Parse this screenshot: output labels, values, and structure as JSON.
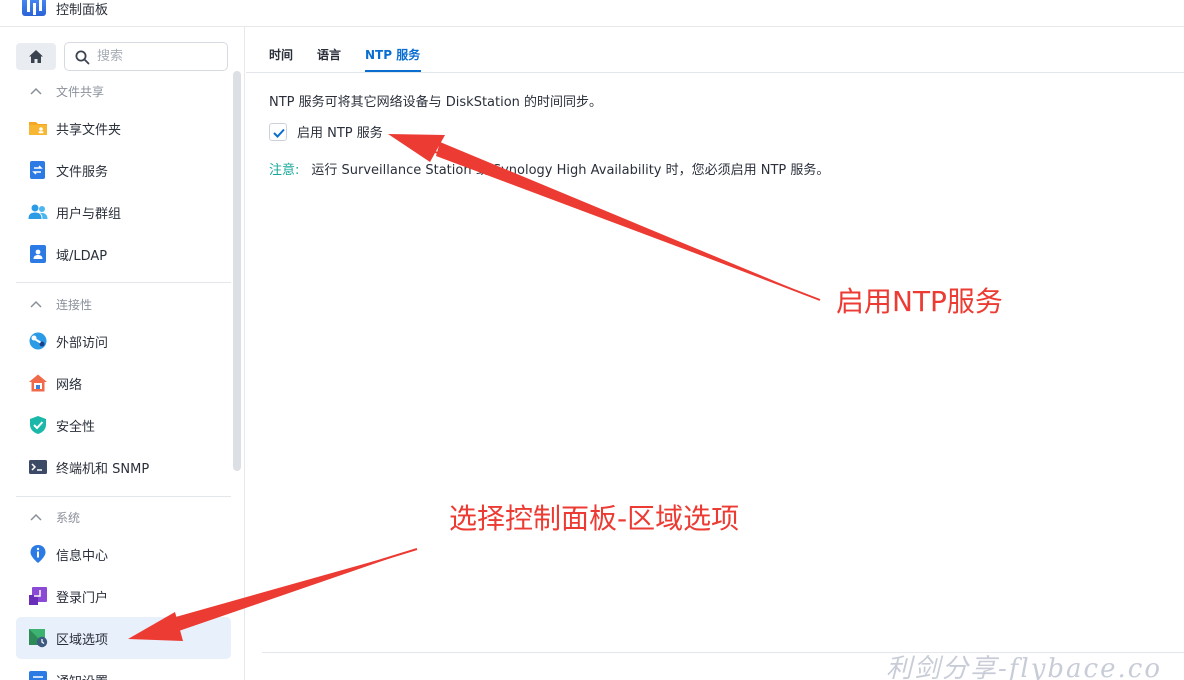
{
  "window": {
    "title": "控制面板"
  },
  "search": {
    "placeholder": "搜索"
  },
  "sidebar": {
    "groups": [
      {
        "label": "文件共享"
      },
      {
        "label": "连接性"
      },
      {
        "label": "系统"
      }
    ],
    "items": [
      {
        "label": "共享文件夹",
        "icon": "shared-folder-icon"
      },
      {
        "label": "文件服务",
        "icon": "file-services-icon"
      },
      {
        "label": "用户与群组",
        "icon": "users-icon"
      },
      {
        "label": "域/LDAP",
        "icon": "ldap-icon"
      },
      {
        "label": "外部访问",
        "icon": "external-access-icon"
      },
      {
        "label": "网络",
        "icon": "network-icon"
      },
      {
        "label": "安全性",
        "icon": "shield-icon"
      },
      {
        "label": "终端机和 SNMP",
        "icon": "terminal-icon"
      },
      {
        "label": "信息中心",
        "icon": "info-icon"
      },
      {
        "label": "登录门户",
        "icon": "login-portal-icon"
      },
      {
        "label": "区域选项",
        "icon": "regional-options-icon",
        "active": true
      },
      {
        "label": "通知设置",
        "icon": "notification-icon"
      }
    ]
  },
  "tabs": [
    {
      "label": "时间"
    },
    {
      "label": "语言"
    },
    {
      "label": "NTP 服务",
      "active": true
    }
  ],
  "main": {
    "description": "NTP 服务可将其它网络设备与 DiskStation 的时间同步。",
    "enable_ntp": {
      "label": "启用 NTP 服务",
      "checked": true
    },
    "note_tag": "注意:",
    "note_text": "运行 Surveillance Station 或 Synology High Availability 时，您必须启用 NTP 服务。"
  },
  "annotations": {
    "enable_ntp": "启用NTP服务",
    "select_panel": "选择控制面板-区域选项"
  },
  "watermark": "利剑分享-flybace.co",
  "colors": {
    "accent": "#0a6ed1",
    "annotation": "#ec3b33",
    "note": "#17a79a",
    "active_bg": "#e8f0fb"
  }
}
